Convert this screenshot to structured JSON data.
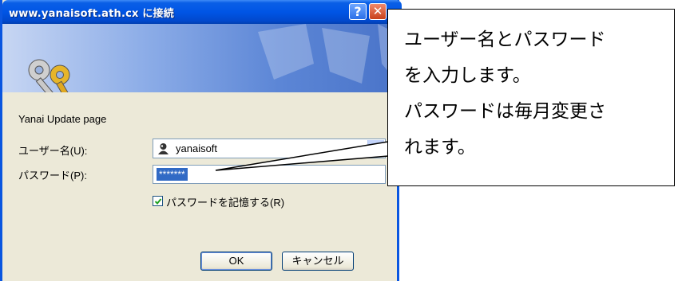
{
  "dialog": {
    "title": "www.yanaisoft.ath.cx に接続",
    "help_glyph": "?",
    "close_glyph": "✕",
    "realm": "Yanai Update page",
    "username_label": "ユーザー名(U):",
    "username_value": "yanaisoft",
    "password_label": "パスワード(P):",
    "password_value": "*******",
    "remember_label": "パスワードを記憶する(R)",
    "remember_checked": true,
    "ok_label": "OK",
    "cancel_label": "キャンセル"
  },
  "callout": {
    "lines": [
      "ユーザー名とパスワード",
      "を入力します。",
      "パスワードは毎月変更さ",
      "れます。"
    ]
  },
  "icons": {
    "banner": "keys-icon",
    "user": "user-icon",
    "help": "help-icon",
    "close": "close-icon"
  },
  "colors": {
    "titlebar": "#0055e5",
    "dialog_bg": "#ece9d8",
    "selection": "#316ac5"
  }
}
